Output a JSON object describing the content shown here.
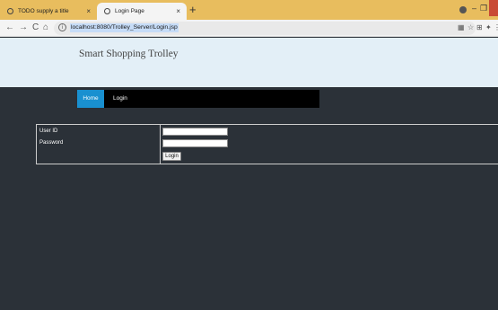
{
  "browser": {
    "tabs": [
      {
        "title": "TODO supply a title",
        "close": "×",
        "active": false
      },
      {
        "title": "Login Page",
        "close": "×",
        "active": true
      }
    ],
    "new_tab": "+",
    "window_controls": {
      "minimize": "–",
      "restore": "❐",
      "close": "✕"
    },
    "nav": {
      "back": "←",
      "forward": "→",
      "reload": "C",
      "home": "⌂"
    },
    "address": {
      "info": "i",
      "url": "localhost:8080/Trolley_Server/Login.jsp"
    },
    "toolbar_icons": {
      "reading_mode": "▦",
      "bookmark": "☆",
      "extension": "⊞",
      "puzzle": "✦",
      "profile": "●",
      "menu": "⋮"
    }
  },
  "page": {
    "site_title": "Smart Shopping Trolley",
    "nav": {
      "home": "Home",
      "login": "Login"
    },
    "form": {
      "user_id_label": "User ID",
      "password_label": "Password",
      "user_id_value": "",
      "password_value": "",
      "submit_label": "Login"
    }
  }
}
